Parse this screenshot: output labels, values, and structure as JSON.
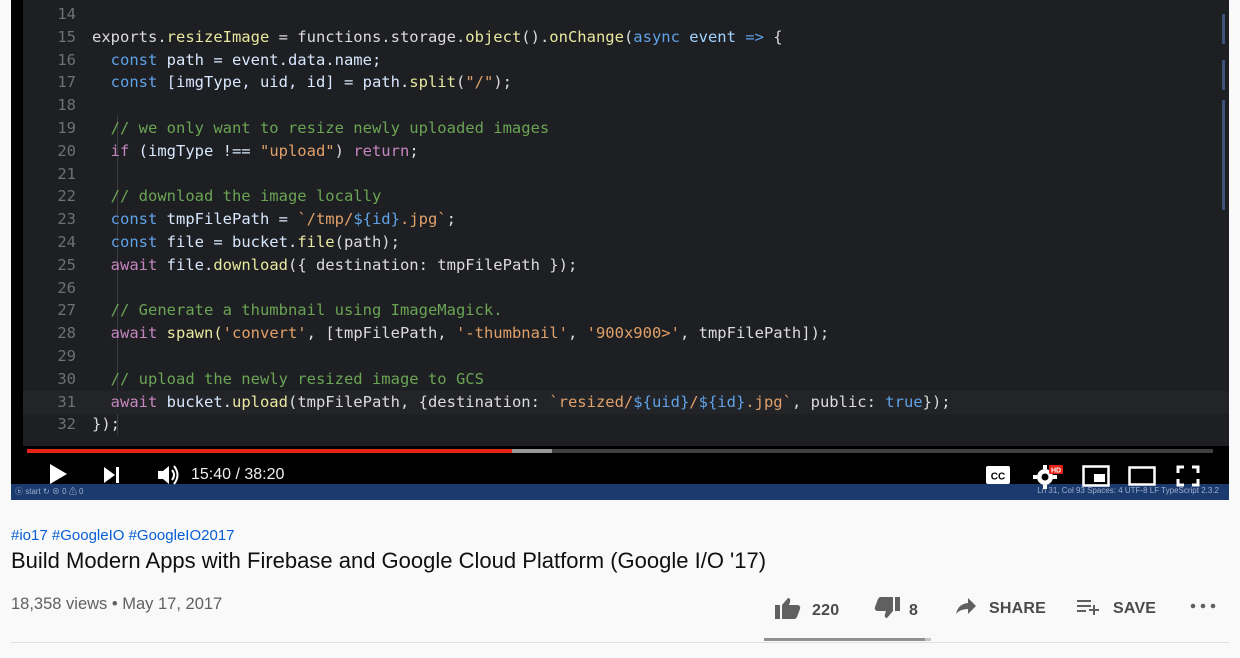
{
  "player": {
    "time": "15:40 / 38:20",
    "progress": {
      "played_fraction": 0.4087,
      "buffered_fraction": 0.4425
    },
    "status_bar": {
      "left": "ⓑ start  ↻  ⊗ 0 ⚠ 0",
      "right": "Ln 31, Col 93   Spaces: 4   UTF-8   LF   TypeScript  2.3.2"
    },
    "code_lines": [
      {
        "n": "14",
        "segs": []
      },
      {
        "n": "15",
        "segs": [
          [
            "exports.",
            "#dcdcdc"
          ],
          [
            "resizeImage",
            "#e8e8a0"
          ],
          [
            " = functions.storage.",
            "#dcdcdc"
          ],
          [
            "object",
            "#e8e8a0"
          ],
          [
            "().",
            "#dcdcdc"
          ],
          [
            "onChange",
            "#e8e8a0"
          ],
          [
            "(",
            "#dcdcdc"
          ],
          [
            "async",
            "#5ea2e8"
          ],
          [
            " event ",
            "#9fd3ff"
          ],
          [
            "=>",
            "#5ea2e8"
          ],
          [
            " {",
            "#dcdcdc"
          ]
        ]
      },
      {
        "n": "16",
        "segs": [
          [
            "  const",
            "#5ea2e8"
          ],
          [
            " path = event.data.name;",
            "#d8e8ff"
          ]
        ]
      },
      {
        "n": "17",
        "segs": [
          [
            "  const",
            "#5ea2e8"
          ],
          [
            " [imgType, uid, id] = path.",
            "#d8e8ff"
          ],
          [
            "split",
            "#e8e8a0"
          ],
          [
            "(",
            "#dcdcdc"
          ],
          [
            "\"/\"",
            "#e0a06a"
          ],
          [
            ");",
            "#dcdcdc"
          ]
        ]
      },
      {
        "n": "18",
        "segs": []
      },
      {
        "n": "19",
        "segs": [
          [
            "  // we only want to resize newly uploaded images",
            "#6aa454"
          ]
        ]
      },
      {
        "n": "20",
        "segs": [
          [
            "  if",
            "#c586c0"
          ],
          [
            " (imgType !== ",
            "#d8e8ff"
          ],
          [
            "\"upload\"",
            "#e0a06a"
          ],
          [
            ") ",
            "#dcdcdc"
          ],
          [
            "return",
            "#c586c0"
          ],
          [
            ";",
            "#dcdcdc"
          ]
        ]
      },
      {
        "n": "21",
        "segs": []
      },
      {
        "n": "22",
        "segs": [
          [
            "  // download the image locally",
            "#6aa454"
          ]
        ]
      },
      {
        "n": "23",
        "segs": [
          [
            "  const",
            "#5ea2e8"
          ],
          [
            " tmpFilePath = ",
            "#d8e8ff"
          ],
          [
            "`/tmp/",
            "#e0a06a"
          ],
          [
            "${id}",
            "#5ea2e8"
          ],
          [
            ".jpg`",
            "#e0a06a"
          ],
          [
            ";",
            "#dcdcdc"
          ]
        ]
      },
      {
        "n": "24",
        "segs": [
          [
            "  const",
            "#5ea2e8"
          ],
          [
            " file = bucket.",
            "#d8e8ff"
          ],
          [
            "file",
            "#e8e8a0"
          ],
          [
            "(path);",
            "#dcdcdc"
          ]
        ]
      },
      {
        "n": "25",
        "segs": [
          [
            "  await",
            "#c586c0"
          ],
          [
            " file.",
            "#d8e8ff"
          ],
          [
            "download",
            "#e8e8a0"
          ],
          [
            "({ destination: tmpFilePath });",
            "#dcdcdc"
          ]
        ]
      },
      {
        "n": "26",
        "segs": []
      },
      {
        "n": "27",
        "segs": [
          [
            "  // Generate a thumbnail using ImageMagick.",
            "#6aa454"
          ]
        ]
      },
      {
        "n": "28",
        "segs": [
          [
            "  await",
            "#c586c0"
          ],
          [
            " spawn(",
            "#e8e8a0"
          ],
          [
            "'convert'",
            "#e0a06a"
          ],
          [
            ", [tmpFilePath, ",
            "#dcdcdc"
          ],
          [
            "'-thumbnail'",
            "#e0a06a"
          ],
          [
            ", ",
            "#dcdcdc"
          ],
          [
            "'900x900>'",
            "#e0a06a"
          ],
          [
            ", tmpFilePath]);",
            "#dcdcdc"
          ]
        ]
      },
      {
        "n": "29",
        "segs": []
      },
      {
        "n": "30",
        "segs": [
          [
            "  // upload the newly resized image to GCS",
            "#6aa454"
          ]
        ]
      },
      {
        "n": "31",
        "segs": [
          [
            "  await",
            "#c586c0"
          ],
          [
            " bucket.",
            "#d8e8ff"
          ],
          [
            "upload",
            "#e8e8a0"
          ],
          [
            "(tmpFilePath, {destination: ",
            "#dcdcdc"
          ],
          [
            "`resized/",
            "#e0a06a"
          ],
          [
            "${uid}",
            "#5ea2e8"
          ],
          [
            "/",
            "#e0a06a"
          ],
          [
            "${id}",
            "#5ea2e8"
          ],
          [
            ".jpg`",
            "#e0a06a"
          ],
          [
            ", public: ",
            "#dcdcdc"
          ],
          [
            "true",
            "#5ea2e8"
          ],
          [
            "});",
            "#dcdcdc"
          ]
        ]
      },
      {
        "n": "32",
        "segs": [
          [
            "});",
            "#dcdcdc"
          ]
        ]
      }
    ],
    "controls": {
      "play_icon": "play-icon",
      "next_icon": "skip-next-icon",
      "volume_icon": "volume-icon",
      "cc_label": "CC",
      "hd_badge": "HD"
    }
  },
  "video": {
    "hashtags": "#io17 #GoogleIO #GoogleIO2017",
    "title": "Build Modern Apps with Firebase and Google Cloud Platform (Google I/O '17)",
    "views_date": "18,358 views • May 17, 2017",
    "likes": "220",
    "dislikes": "8",
    "share_label": "SHARE",
    "save_label": "SAVE",
    "like_ratio": 0.965
  },
  "colors": {
    "accent": "#e62117",
    "link": "#065fd4"
  }
}
